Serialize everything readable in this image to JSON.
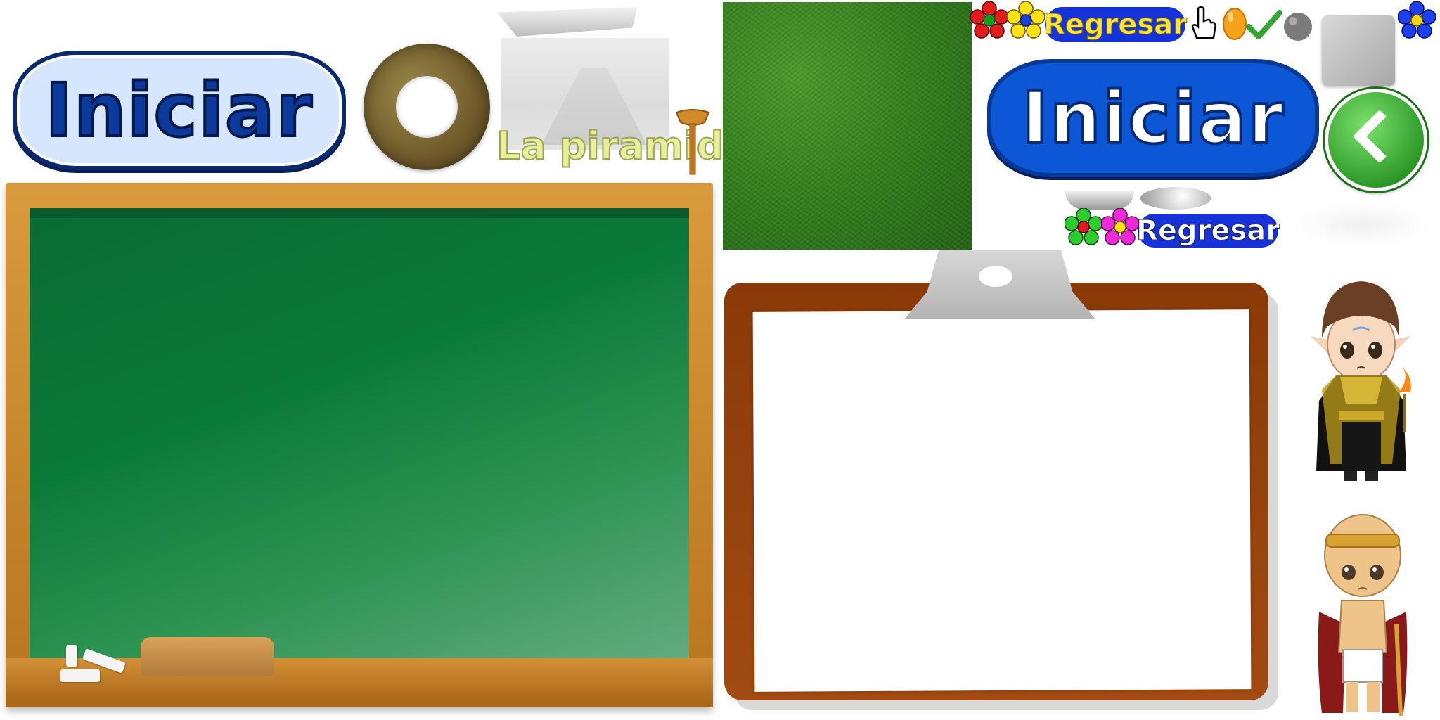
{
  "buttons": {
    "iniciar_light": "Iniciar",
    "iniciar_dark": "Iniciar",
    "regresar_yellow": "Regresar",
    "regresar_white": "Regresar"
  },
  "labels": {
    "piramide_title": "La piramide"
  },
  "icons": [
    "flower-red-icon",
    "flower-yellow-icon",
    "hand-cursor-icon",
    "orange-gem-icon",
    "checkmark-icon",
    "gray-ball-icon",
    "flower-blue-icon",
    "flower-green-icon",
    "flower-magenta-icon",
    "back-arrow-icon"
  ],
  "colors": {
    "chalkboard_green": "#0a7a38",
    "frame_wood": "#c8852c",
    "clipboard_brown": "#8a3a08",
    "button_blue": "#0b57d6",
    "regresar_blue": "#1533d8",
    "grass_green": "#2f7a1a"
  }
}
